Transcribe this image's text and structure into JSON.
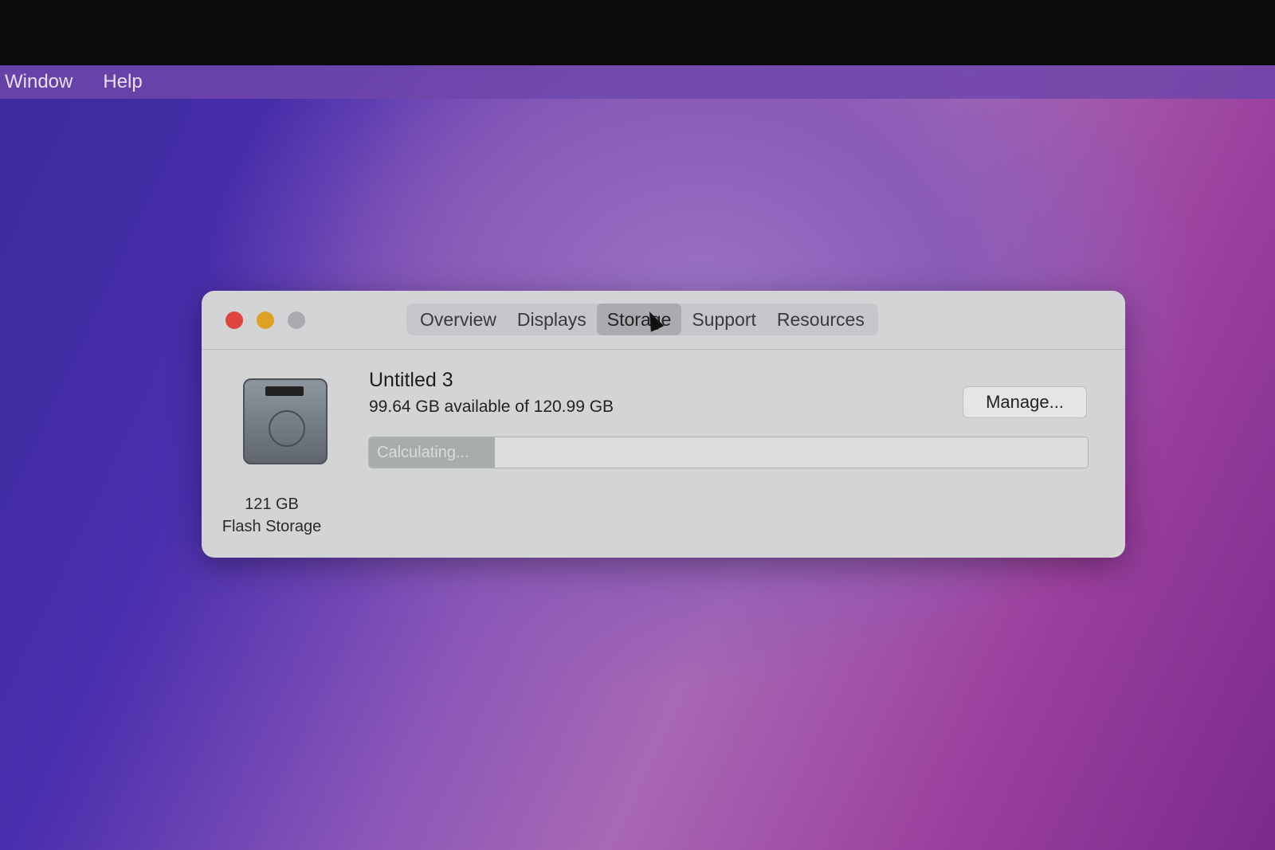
{
  "menubar": {
    "items": [
      "Window",
      "Help"
    ]
  },
  "window": {
    "tabs": [
      "Overview",
      "Displays",
      "Storage",
      "Support",
      "Resources"
    ],
    "active_tab": "Storage",
    "disk": {
      "size": "121 GB",
      "type": "Flash Storage"
    },
    "volume": {
      "name": "Untitled 3",
      "availability": "99.64 GB available of 120.99 GB",
      "status": "Calculating...",
      "progress_fraction": 0.175
    },
    "manage_label": "Manage...",
    "colors": {
      "close": "#e0443e",
      "minimize": "#dea123",
      "zoom": "#a8aaad"
    }
  }
}
